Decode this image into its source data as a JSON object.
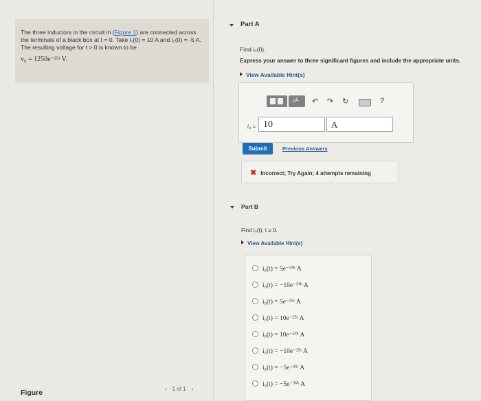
{
  "problem": {
    "intro": "The three inductors in the circuit in (",
    "figure_link": "Figure 1",
    "mid": ") are connected across the terminals of a black box at t = 0. Take i₁(0) = 10 A and i₂(0) = -5 A. The resulting voltage for t > 0 is known to be",
    "vo_equation": "v₀ = 1250e⁻²⁵ᵗ V."
  },
  "figure": {
    "label": "Figure",
    "pager": "1 of 1"
  },
  "partA": {
    "title": "Part A",
    "question": "Find i₀(0).",
    "instruction": "Express your answer to three significant figures and include the appropriate units.",
    "hints_label": "View Available Hint(s)",
    "answer_label": "i₀ =",
    "answer_value": "10",
    "answer_unit": "A",
    "submit_label": "Submit",
    "previous_label": "Previous Answers",
    "feedback": "Incorrect; Try Again; 4 attempts remaining",
    "toolbar_icons": [
      "templates-icon",
      "units-icon",
      "undo-icon",
      "redo-icon",
      "reset-icon",
      "keyboard-icon",
      "help-icon"
    ],
    "help_glyph": "?"
  },
  "partB": {
    "title": "Part B",
    "question": "Find i₀(t), t ≥ 0.",
    "hints_label": "View Available Hint(s)",
    "choices": [
      "i₀(t) = 5e⁻⁵⁰ᵗ A",
      "i₀(t) = −10e⁻⁵⁰ᵗ A",
      "i₀(t) = 5e⁻²⁵ᵗ A",
      "i₀(t) = 10e⁻²⁵ᵗ A",
      "i₀(t) = 10e⁻⁵⁰ᵗ A",
      "i₀(t) = −10e⁻²⁵ᵗ A",
      "i₀(t) = −5e⁻²⁵ᵗ A",
      "i₀(t) = −5e⁻⁵⁰ᵗ A"
    ]
  },
  "colors": {
    "submit": "#1f6fb6",
    "error": "#c4312a",
    "link": "#2b5a8f"
  }
}
